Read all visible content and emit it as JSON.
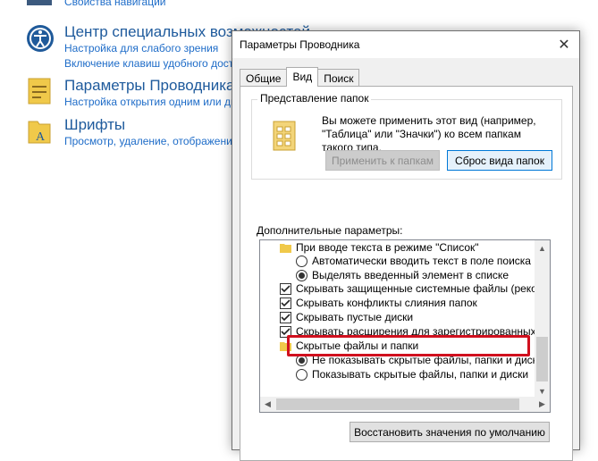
{
  "control_panel": {
    "top_partial_link": "Свойства навигации",
    "items": [
      {
        "title": "Центр специальных возможностей",
        "links": [
          "Настройка для слабого зрения",
          "Включение клавиш удобного доступа"
        ]
      },
      {
        "title": "Параметры Проводника",
        "links": [
          "Настройка открытия одним или двойным щелчком"
        ]
      },
      {
        "title": "Шрифты",
        "links": [
          "Просмотр, удаление, отображение и скрытие шрифтов"
        ]
      }
    ]
  },
  "dialog": {
    "title": "Параметры Проводника",
    "close_glyph": "✕",
    "tabs": [
      "Общие",
      "Вид",
      "Поиск"
    ],
    "active_tab": "Вид",
    "folder_views": {
      "group_label": "Представление папок",
      "description": "Вы можете применить этот вид (например, \"Таблица\" или \"Значки\") ко всем папкам такого типа.",
      "apply_button": "Применить к папкам",
      "reset_button": "Сброс вида папок"
    },
    "advanced_label": "Дополнительные параметры:",
    "tree_items": [
      {
        "type": "folder",
        "text": "При вводе текста в режиме \"Список\"",
        "indent": 0
      },
      {
        "type": "radio",
        "text": "Автоматически вводить текст в поле поиска",
        "checked": false,
        "indent": 1
      },
      {
        "type": "radio",
        "text": "Выделять введенный элемент в списке",
        "checked": true,
        "indent": 1
      },
      {
        "type": "checkbox",
        "text": "Скрывать защищенные системные файлы (рекомен",
        "checked": true,
        "indent": 0
      },
      {
        "type": "checkbox",
        "text": "Скрывать конфликты слияния папок",
        "checked": true,
        "indent": 0
      },
      {
        "type": "checkbox",
        "text": "Скрывать пустые диски",
        "checked": true,
        "indent": 0
      },
      {
        "type": "checkbox",
        "text": "Скрывать расширения для зарегистрированных типо",
        "checked": true,
        "indent": 0
      },
      {
        "type": "folder",
        "text": "Скрытые файлы и папки",
        "indent": 0
      },
      {
        "type": "radio",
        "text": "Не показывать скрытые файлы, папки и диски",
        "checked": true,
        "indent": 1
      },
      {
        "type": "radio",
        "text": "Показывать скрытые файлы, папки и диски",
        "checked": false,
        "indent": 1
      }
    ],
    "restore_button": "Восстановить значения по умолчанию"
  },
  "colors": {
    "link_blue": "#1e6cc8",
    "highlight_red": "#d0101e",
    "folder_yellow": "#f0c94a"
  }
}
